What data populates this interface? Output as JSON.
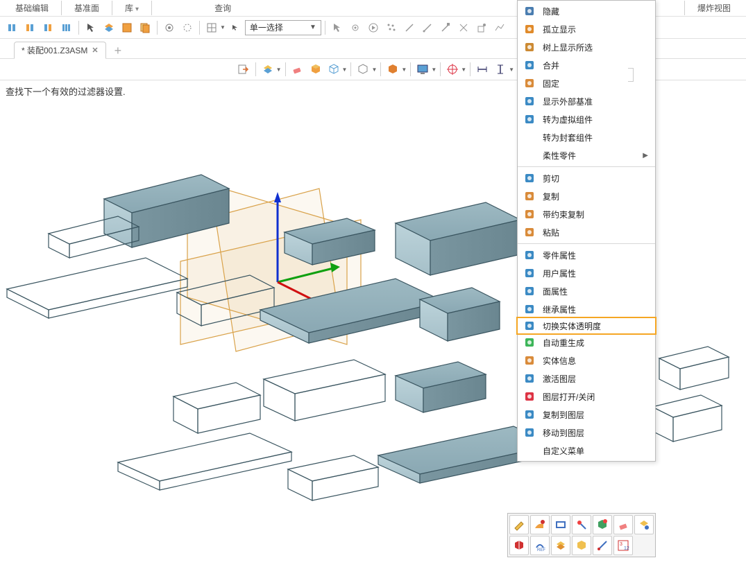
{
  "menu": {
    "tabs": [
      "基础编辑",
      "基准面",
      "库",
      "查询",
      "爆炸视图"
    ]
  },
  "toolbar": {
    "select_label": "单一选择"
  },
  "file_tab": {
    "title": "* 装配001.Z3ASM"
  },
  "status": {
    "text": "查找下一个有效的过滤器设置."
  },
  "context_menu": {
    "items": [
      {
        "label": "隐藏",
        "icon": "hide-icon",
        "color": "#4a7db0"
      },
      {
        "label": "孤立显示",
        "icon": "isolate-icon",
        "color": "#e08a2a"
      },
      {
        "label": "树上显示所选",
        "icon": "tree-select-icon",
        "color": "#cc8a33"
      },
      {
        "label": "合并",
        "icon": "merge-icon",
        "color": "#3b8ac4"
      },
      {
        "label": "固定",
        "icon": "fix-icon",
        "color": "#d98b3a"
      },
      {
        "label": "显示外部基准",
        "icon": "ext-datum-icon",
        "color": "#3b8ac4"
      },
      {
        "label": "转为虚拟组件",
        "icon": "virtual-icon",
        "color": "#3b8ac4"
      },
      {
        "label": "转为封套组件",
        "icon": "envelope-icon",
        "color": ""
      },
      {
        "label": "柔性零件",
        "icon": "flex-icon",
        "color": "",
        "submenu": true
      },
      {
        "sep": true
      },
      {
        "label": "剪切",
        "icon": "cut-icon",
        "color": "#3b8ac4"
      },
      {
        "label": "复制",
        "icon": "copy-icon",
        "color": "#d98b3a"
      },
      {
        "label": "带约束复制",
        "icon": "copy-constraint-icon",
        "color": "#d98b3a"
      },
      {
        "label": "粘贴",
        "icon": "paste-icon",
        "color": "#d98b3a"
      },
      {
        "sep": true
      },
      {
        "label": "零件属性",
        "icon": "part-attr-icon",
        "color": "#3b8ac4"
      },
      {
        "label": "用户属性",
        "icon": "user-attr-icon",
        "color": "#3b8ac4"
      },
      {
        "label": "面属性",
        "icon": "face-attr-icon",
        "color": "#3b8ac4"
      },
      {
        "label": "继承属性",
        "icon": "inherit-attr-icon",
        "color": "#3b8ac4"
      },
      {
        "label": "切换实体透明度",
        "icon": "transparency-icon",
        "color": "#3b8ac4",
        "highlight": true
      },
      {
        "label": "自动重生成",
        "icon": "regen-icon",
        "color": "#3db559"
      },
      {
        "label": "实体信息",
        "icon": "entity-info-icon",
        "color": "#d98b3a"
      },
      {
        "label": "激活图层",
        "icon": "activate-layer-icon",
        "color": "#3b8ac4"
      },
      {
        "label": "图层打开/关闭",
        "icon": "layer-toggle-icon",
        "color": "#d34"
      },
      {
        "label": "复制到图层",
        "icon": "copy-layer-icon",
        "color": "#3b8ac4"
      },
      {
        "label": "移动到图层",
        "icon": "move-layer-icon",
        "color": "#3b8ac4"
      },
      {
        "label": "自定义菜单",
        "icon": "custom-menu-icon",
        "color": ""
      }
    ]
  }
}
